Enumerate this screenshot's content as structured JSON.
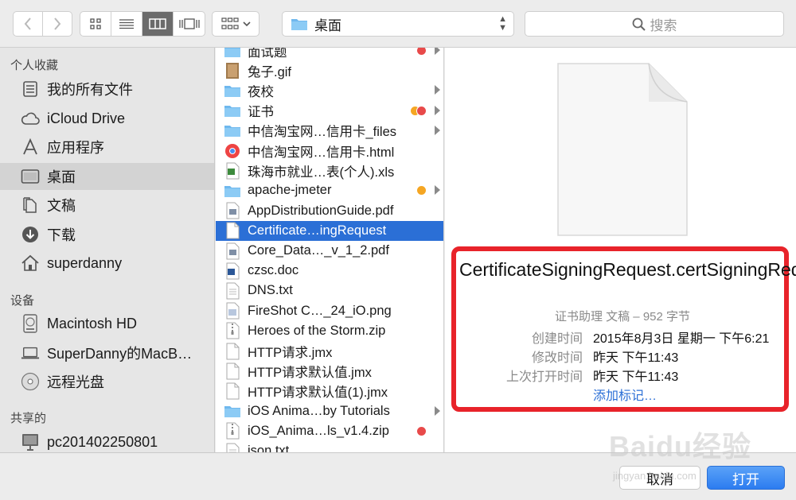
{
  "toolbar": {
    "back_icon": "chevron-left-icon",
    "forward_icon": "chevron-right-icon",
    "path_label": "桌面",
    "search_placeholder": "搜索"
  },
  "sidebar": {
    "sections": [
      {
        "title": "个人收藏"
      },
      {
        "title": "设备"
      },
      {
        "title": "共享的"
      }
    ],
    "favorites": [
      {
        "label": "我的所有文件",
        "icon": "all-files-icon"
      },
      {
        "label": "iCloud Drive",
        "icon": "cloud-icon"
      },
      {
        "label": "应用程序",
        "icon": "applications-icon"
      },
      {
        "label": "桌面",
        "icon": "desktop-icon"
      },
      {
        "label": "文稿",
        "icon": "documents-icon"
      },
      {
        "label": "下载",
        "icon": "download-icon"
      },
      {
        "label": "superdanny",
        "icon": "home-icon"
      }
    ],
    "devices": [
      {
        "label": "Macintosh HD",
        "icon": "hard-disk-icon"
      },
      {
        "label": "SuperDanny的MacB…",
        "icon": "laptop-icon"
      },
      {
        "label": "远程光盘",
        "icon": "disc-icon"
      }
    ],
    "shared": [
      {
        "label": "pc201402250801",
        "icon": "computer-icon"
      }
    ]
  },
  "files": [
    {
      "name": "面试题",
      "type": "folder",
      "tags": [
        "#e84a4a"
      ],
      "expandable": true
    },
    {
      "name": "兔子.gif",
      "type": "image"
    },
    {
      "name": "夜校",
      "type": "folder",
      "expandable": true
    },
    {
      "name": "证书",
      "type": "folder",
      "tags": [
        "#f5a623",
        "#e84a4a"
      ],
      "expandable": true
    },
    {
      "name": "中信淘宝网…信用卡_files",
      "type": "folder",
      "expandable": true
    },
    {
      "name": "中信淘宝网…信用卡.html",
      "type": "html"
    },
    {
      "name": "珠海市就业…表(个人).xls",
      "type": "xls"
    },
    {
      "name": "apache-jmeter",
      "type": "folder",
      "tags": [
        "#f5a623"
      ],
      "expandable": true
    },
    {
      "name": "AppDistributionGuide.pdf",
      "type": "pdf"
    },
    {
      "name": "Certificate…ingRequest",
      "type": "doc",
      "selected": true
    },
    {
      "name": "Core_Data…_v_1_2.pdf",
      "type": "pdf"
    },
    {
      "name": "czsc.doc",
      "type": "word"
    },
    {
      "name": "DNS.txt",
      "type": "txt"
    },
    {
      "name": "FireShot C…_24_iO.png",
      "type": "png"
    },
    {
      "name": "Heroes of the Storm.zip",
      "type": "zip"
    },
    {
      "name": "HTTP请求.jmx",
      "type": "doc"
    },
    {
      "name": "HTTP请求默认值.jmx",
      "type": "doc"
    },
    {
      "name": "HTTP请求默认值(1).jmx",
      "type": "doc"
    },
    {
      "name": "iOS Anima…by Tutorials",
      "type": "folder",
      "expandable": true
    },
    {
      "name": "iOS_Anima…ls_v1.4.zip",
      "type": "zip",
      "tags": [
        "#e84a4a"
      ]
    },
    {
      "name": "json.txt",
      "type": "txt"
    }
  ],
  "preview": {
    "file_name": "CertificateSigningRequest.certSigningRequest",
    "kind_line": "证书助理 文稿 – 952 字节",
    "rows": [
      {
        "key": "创建时间",
        "value": "2015年8月3日 星期一 下午6:21"
      },
      {
        "key": "修改时间",
        "value": "昨天 下午11:43"
      },
      {
        "key": "上次打开时间",
        "value": "昨天 下午11:43"
      }
    ],
    "add_tags": "添加标记…"
  },
  "buttons": {
    "cancel": "取消",
    "open": "打开"
  },
  "watermark": {
    "text": "Baidu经验",
    "url": "jingyan.baidu.com"
  }
}
